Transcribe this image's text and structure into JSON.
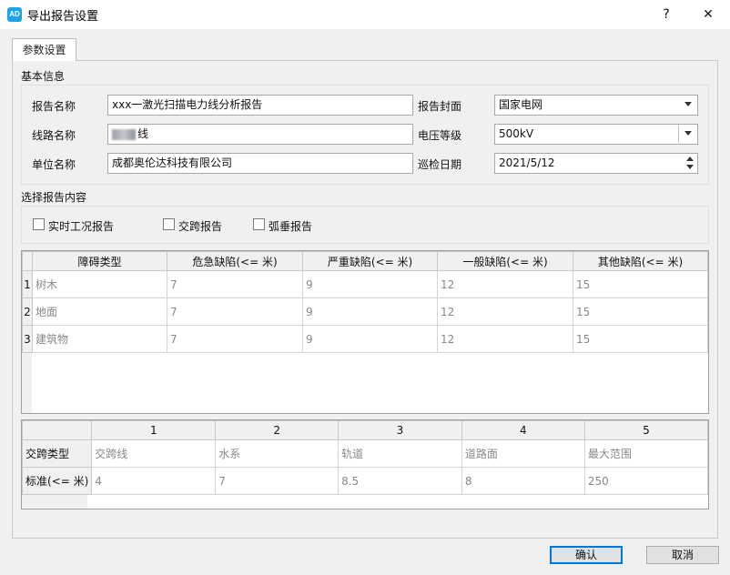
{
  "window": {
    "title": "导出报告设置",
    "icon_text": "AD",
    "help_label": "?",
    "close_label": "✕"
  },
  "tabs": [
    {
      "label": "参数设置"
    }
  ],
  "basic_info": {
    "section_label": "基本信息",
    "fields": {
      "report_name": {
        "label": "报告名称",
        "value": "xxx一激光扫描电力线分析报告"
      },
      "line_name": {
        "label": "线路名称",
        "value": "线"
      },
      "unit_name": {
        "label": "单位名称",
        "value": "成都奥伦达科技有限公司"
      },
      "report_cover": {
        "label": "报告封面",
        "value": "国家电网"
      },
      "voltage_level": {
        "label": "电压等级",
        "value": "500kV"
      },
      "inspection_date": {
        "label": "巡检日期",
        "value": "2021/5/12"
      }
    }
  },
  "report_content": {
    "section_label": "选择报告内容",
    "options": [
      {
        "label": "实时工况报告",
        "checked": false
      },
      {
        "label": "交跨报告",
        "checked": false
      },
      {
        "label": "弧垂报告",
        "checked": false
      }
    ]
  },
  "defect_table": {
    "columns": [
      "障碍类型",
      "危急缺陷(<= 米)",
      "严重缺陷(<= 米)",
      "一般缺陷(<= 米)",
      "其他缺陷(<= 米)"
    ],
    "rows": [
      {
        "num": "1",
        "cells": [
          "树木",
          "7",
          "9",
          "12",
          "15"
        ]
      },
      {
        "num": "2",
        "cells": [
          "地面",
          "7",
          "9",
          "12",
          "15"
        ]
      },
      {
        "num": "3",
        "cells": [
          "建筑物",
          "7",
          "9",
          "12",
          "15"
        ]
      }
    ]
  },
  "crossing_table": {
    "columns": [
      "1",
      "2",
      "3",
      "4",
      "5"
    ],
    "rows": [
      {
        "header": "交跨类型",
        "cells": [
          "交跨线",
          "水系",
          "轨道",
          "道路面",
          "最大范围"
        ]
      },
      {
        "header": "标准(<= 米)",
        "cells": [
          "4",
          "7",
          "8.5",
          "8",
          "250"
        ]
      }
    ]
  },
  "buttons": {
    "ok_label": "确认",
    "cancel_label": "取消"
  }
}
